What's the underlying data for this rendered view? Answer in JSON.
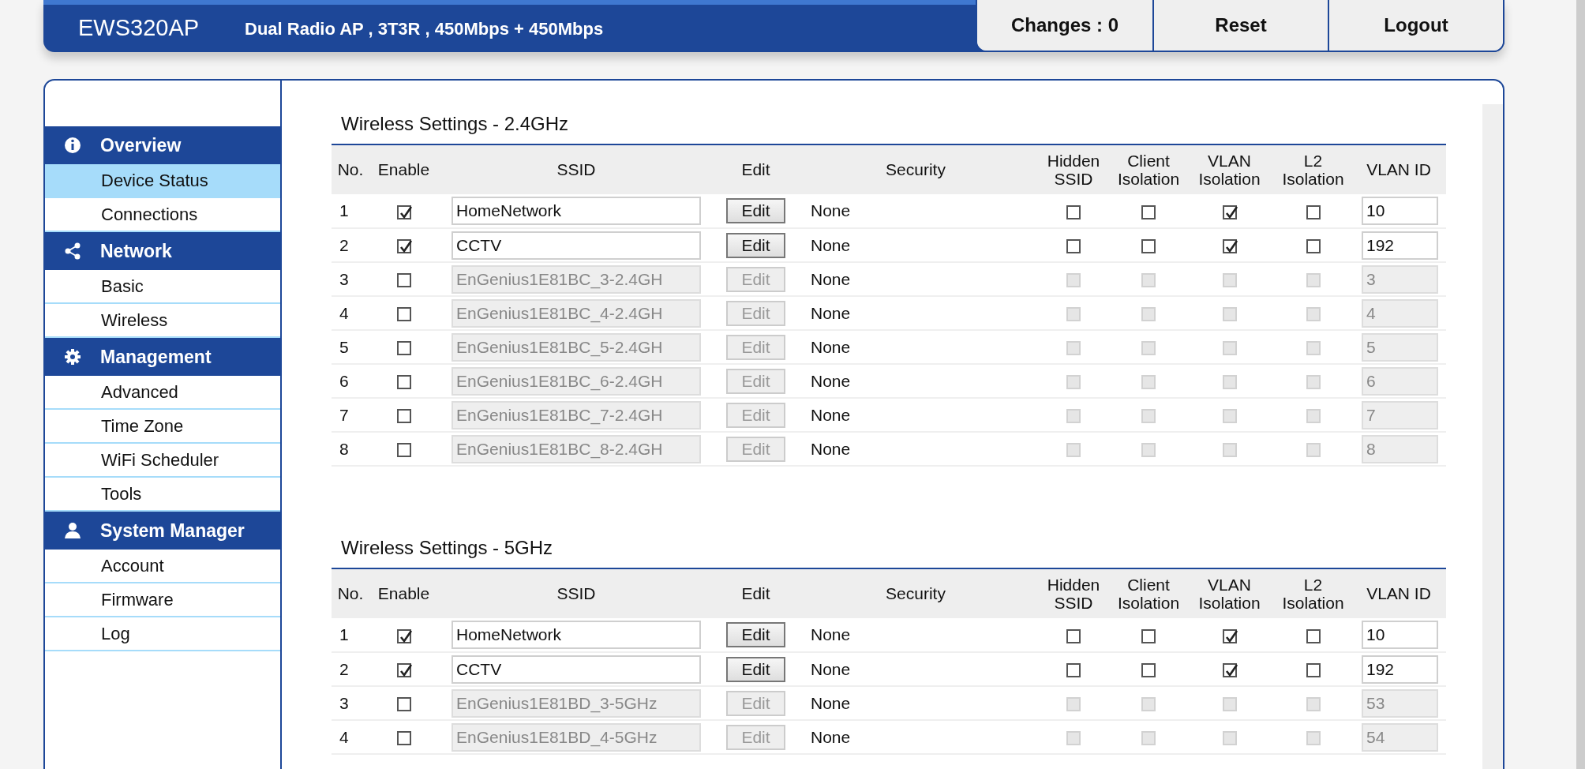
{
  "header": {
    "model": "EWS320AP",
    "description": "Dual Radio AP , 3T3R , 450Mbps + 450Mbps",
    "buttons": [
      "Changes : 0",
      "Reset",
      "Logout"
    ]
  },
  "sidebar": [
    {
      "title": "Overview",
      "kind": "info",
      "items": [
        {
          "label": "Device Status",
          "selected": true
        },
        {
          "label": "Connections",
          "selected": false
        }
      ]
    },
    {
      "title": "Network",
      "kind": "share",
      "items": [
        {
          "label": "Basic",
          "selected": false
        },
        {
          "label": "Wireless",
          "selected": false
        }
      ]
    },
    {
      "title": "Management",
      "kind": "gear",
      "items": [
        {
          "label": "Advanced",
          "selected": false
        },
        {
          "label": "Time Zone",
          "selected": false
        },
        {
          "label": "WiFi Scheduler",
          "selected": false
        },
        {
          "label": "Tools",
          "selected": false
        }
      ]
    },
    {
      "title": "System Manager",
      "kind": "user",
      "items": [
        {
          "label": "Account",
          "selected": false
        },
        {
          "label": "Firmware",
          "selected": false
        },
        {
          "label": "Log",
          "selected": false
        }
      ]
    }
  ],
  "sections": [
    {
      "title": "Wireless Settings - 2.4GHz",
      "columns": [
        "No.",
        "Enable",
        "SSID",
        "Edit",
        "Security",
        "Hidden SSID",
        "Client Isolation",
        "VLAN Isolation",
        "L2 Isolation",
        "VLAN ID"
      ],
      "rows": [
        {
          "no": "1",
          "enabled": true,
          "ssid": "HomeNetwork",
          "edit": "Edit",
          "security": "None",
          "hidden_ssid": false,
          "client_isolation": false,
          "vlan_isolation": true,
          "l2_isolation": false,
          "vlan_id": "10"
        },
        {
          "no": "2",
          "enabled": true,
          "ssid": "CCTV",
          "edit": "Edit",
          "security": "None",
          "hidden_ssid": false,
          "client_isolation": false,
          "vlan_isolation": true,
          "l2_isolation": false,
          "vlan_id": "192"
        },
        {
          "no": "3",
          "enabled": false,
          "ssid": "EnGenius1E81BC_3-2.4GH",
          "edit": "Edit",
          "security": "None",
          "hidden_ssid": false,
          "client_isolation": false,
          "vlan_isolation": false,
          "l2_isolation": false,
          "vlan_id": "3"
        },
        {
          "no": "4",
          "enabled": false,
          "ssid": "EnGenius1E81BC_4-2.4GH",
          "edit": "Edit",
          "security": "None",
          "hidden_ssid": false,
          "client_isolation": false,
          "vlan_isolation": false,
          "l2_isolation": false,
          "vlan_id": "4"
        },
        {
          "no": "5",
          "enabled": false,
          "ssid": "EnGenius1E81BC_5-2.4GH",
          "edit": "Edit",
          "security": "None",
          "hidden_ssid": false,
          "client_isolation": false,
          "vlan_isolation": false,
          "l2_isolation": false,
          "vlan_id": "5"
        },
        {
          "no": "6",
          "enabled": false,
          "ssid": "EnGenius1E81BC_6-2.4GH",
          "edit": "Edit",
          "security": "None",
          "hidden_ssid": false,
          "client_isolation": false,
          "vlan_isolation": false,
          "l2_isolation": false,
          "vlan_id": "6"
        },
        {
          "no": "7",
          "enabled": false,
          "ssid": "EnGenius1E81BC_7-2.4GH",
          "edit": "Edit",
          "security": "None",
          "hidden_ssid": false,
          "client_isolation": false,
          "vlan_isolation": false,
          "l2_isolation": false,
          "vlan_id": "7"
        },
        {
          "no": "8",
          "enabled": false,
          "ssid": "EnGenius1E81BC_8-2.4GH",
          "edit": "Edit",
          "security": "None",
          "hidden_ssid": false,
          "client_isolation": false,
          "vlan_isolation": false,
          "l2_isolation": false,
          "vlan_id": "8"
        }
      ]
    },
    {
      "title": "Wireless Settings - 5GHz",
      "columns": [
        "No.",
        "Enable",
        "SSID",
        "Edit",
        "Security",
        "Hidden SSID",
        "Client Isolation",
        "VLAN Isolation",
        "L2 Isolation",
        "VLAN ID"
      ],
      "rows": [
        {
          "no": "1",
          "enabled": true,
          "ssid": "HomeNetwork",
          "edit": "Edit",
          "security": "None",
          "hidden_ssid": false,
          "client_isolation": false,
          "vlan_isolation": true,
          "l2_isolation": false,
          "vlan_id": "10"
        },
        {
          "no": "2",
          "enabled": true,
          "ssid": "CCTV",
          "edit": "Edit",
          "security": "None",
          "hidden_ssid": false,
          "client_isolation": false,
          "vlan_isolation": true,
          "l2_isolation": false,
          "vlan_id": "192"
        },
        {
          "no": "3",
          "enabled": false,
          "ssid": "EnGenius1E81BD_3-5GHz",
          "edit": "Edit",
          "security": "None",
          "hidden_ssid": false,
          "client_isolation": false,
          "vlan_isolation": false,
          "l2_isolation": false,
          "vlan_id": "53"
        },
        {
          "no": "4",
          "enabled": false,
          "ssid": "EnGenius1E81BD_4-5GHz",
          "edit": "Edit",
          "security": "None",
          "hidden_ssid": false,
          "client_isolation": false,
          "vlan_isolation": false,
          "l2_isolation": false,
          "vlan_id": "54"
        }
      ]
    }
  ]
}
